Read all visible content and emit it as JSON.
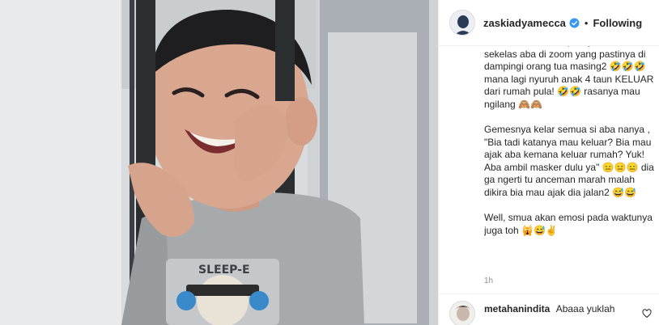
{
  "post": {
    "image_alt": "",
    "header": {
      "username": "zaskiadyamecca",
      "verified": true,
      "separator": "•",
      "follow_label": "Following"
    },
    "caption": {
      "paragraphs": [
        "kesabaran Bia didepan guru dan temen sekelas aba di zoom yang pastinya di dampingi orang tua masing2 🤣🤣🤣 mana lagi nyuruh anak 4 taun KELUAR dari rumah pula! 🤣🤣 rasanya mau ngilang 🙈🙈",
        "Gemesnya kelar semua si aba nanya , \"Bia tadi katanya mau keluar? Bia mau ajak aba kemana keluar rumah? Yuk! Aba ambil masker dulu ya\" 😑😑😑 dia ga ngerti tu anceman marah malah dikira bia mau ajak dia jalan2 😅😅",
        "Well, smua akan emosi pada waktunya juga toh 🙀😅✌"
      ]
    },
    "timestamp": "1h",
    "comments": [
      {
        "username": "metahanindita",
        "text": "Abaaa yuklah"
      }
    ],
    "icons": {
      "verified": "verified-badge-icon",
      "heart": "heart-icon"
    },
    "colors": {
      "verified_blue": "#3897f0",
      "text": "#262626",
      "muted": "#8e8e8e",
      "border": "#efefef"
    }
  }
}
